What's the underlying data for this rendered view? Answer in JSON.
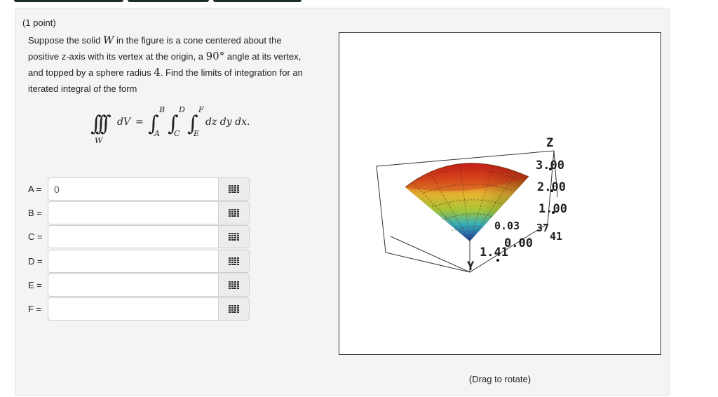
{
  "problem": {
    "points": "(1 point)",
    "text_before_W": "Suppose the solid ",
    "W": "W",
    "text_after_W": " in the figure is a cone centered about the positive z-axis with its vertex at the origin, a ",
    "angle": "90°",
    "text_after_angle": " angle at its vertex, and topped by a sphere radius ",
    "radius": "4",
    "text_after_radius": ". Find the limits of integration for an iterated integral of the form"
  },
  "formula": {
    "region": "W",
    "dV": "dV",
    "equals": "=",
    "upper": [
      "B",
      "D",
      "F"
    ],
    "lower": [
      "A",
      "C",
      "E"
    ],
    "differentials": "dz dy dx."
  },
  "answers": [
    {
      "label": "A =",
      "value": "0"
    },
    {
      "label": "B =",
      "value": ""
    },
    {
      "label": "C =",
      "value": ""
    },
    {
      "label": "D =",
      "value": ""
    },
    {
      "label": "E =",
      "value": ""
    },
    {
      "label": "F =",
      "value": ""
    }
  ],
  "graph": {
    "z_axis_label": "Z",
    "y_axis_label": "Y",
    "z_ticks": [
      "3.00",
      "2.00",
      "1.00"
    ],
    "origin_label": "0.00",
    "y_tick_label": "1.41",
    "x_tick_near": "0.03",
    "x_tick_far": "37",
    "x_tick_end": "41",
    "caption": "(Drag to rotate)"
  },
  "colors": {
    "panel_bg": "#f4f4f4",
    "tab_color": "#1e2e22"
  },
  "icons": {
    "palette": "grid-icon"
  }
}
